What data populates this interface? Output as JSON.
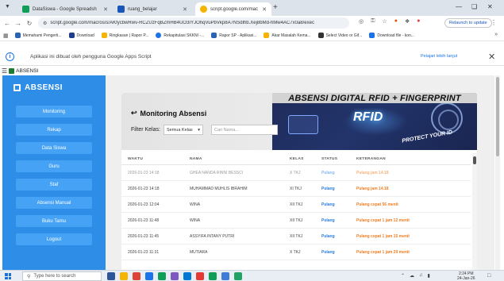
{
  "browser": {
    "tabs": [
      {
        "title": "DataSiswa - Google Spreadsh",
        "color": "#0f9d58",
        "active": false
      },
      {
        "title": "ruang_belajar",
        "color": "#1a56b8",
        "active": false
      },
      {
        "title": "script.google.com/macros/s/A",
        "color": "#f4b400",
        "active": true
      }
    ],
    "url": "script.google.com/macros/s/AKfycbwRwv-RCZUzFqBZmHB4UO3IYJOhqVuPbVkp8A7NSdlhb.Xej8bMd-hMw4AC7x0a8/exec",
    "relaunch_label": "Relaunch to update",
    "bookmarks": [
      {
        "label": "Memahami Pengerti...",
        "color": "#2a62b5"
      },
      {
        "label": "Download",
        "color": "#1c3d8a"
      },
      {
        "label": "Ringkasan | Rapor P...",
        "color": "#f4b400"
      },
      {
        "label": "Rekapitulasi SKKNI -...",
        "color": "#1a73e8"
      },
      {
        "label": "Rapor SP - Aplikasi...",
        "color": "#2a62b5"
      },
      {
        "label": "Akar Masalah Kema...",
        "color": "#f4b400"
      },
      {
        "label": "Select Video or Gif...",
        "color": "#333333"
      },
      {
        "label": "Download file - kon...",
        "color": "#1a73e8"
      }
    ]
  },
  "banner": {
    "text": "Aplikasi ini dibuat oleh pengguna Google Apps Script",
    "link": "Pelajari lebih lanjut"
  },
  "app_title": "ABSENSI",
  "sidebar": {
    "logo": "ABSENSI",
    "items": [
      "Monitoring",
      "Rekap",
      "Data Siswa",
      "Guru",
      "Staf",
      "Absensi Manual",
      "Buku Tamu",
      "Logout"
    ]
  },
  "monitoring": {
    "title": "Monitoring Absensi",
    "filter_label": "Filter Kelas:",
    "filter_value": "Semua Kelas",
    "search_placeholder": "Cari Nama...",
    "hero_title": "ABSENSI DIGITAL RFID + FINGERPRINT",
    "hero_rfid": "RFID",
    "hero_protect": "PROTECT YOUR ID",
    "columns": [
      "WAKTU",
      "NAMA",
      "KELAS",
      "STATUS",
      "KETERANGAN"
    ],
    "rows": [
      {
        "waktu": "2026-01-23 14:18",
        "nama": "GHEA NANDA RINNI BESSCI",
        "kelas": "X TKJ",
        "status": "Pulang",
        "ket": "Pulang jam 14.18",
        "faded": true
      },
      {
        "waktu": "2026-01-23 14:18",
        "nama": "MUHAMMAD MUHLIS IBRAHIM",
        "kelas": "XI TKJ",
        "status": "Pulang",
        "ket": "Pulang jam 14.18",
        "faded": false
      },
      {
        "waktu": "2026-01-23 12:04",
        "nama": "WINA",
        "kelas": "XII TKJ",
        "status": "Pulang",
        "ket": "Pulang cepat 56 menit",
        "faded": false
      },
      {
        "waktu": "2026-01-23 11:48",
        "nama": "WINA",
        "kelas": "XII TKJ",
        "status": "Pulang",
        "ket": "Pulang cepat 1 jam 12 menit",
        "faded": false
      },
      {
        "waktu": "2026-01-23 11:45",
        "nama": "ASSYIFA INTANY PUTRI",
        "kelas": "XII TKJ",
        "status": "Pulang",
        "ket": "Pulang cepat 1 jam 15 menit",
        "faded": false
      },
      {
        "waktu": "2026-01-23 11:31",
        "nama": "MUTIARA",
        "kelas": "X TKJ",
        "status": "Pulang",
        "ket": "Pulang cepat 1 jam 29 menit",
        "faded": false
      }
    ]
  },
  "taskbar": {
    "search_placeholder": "Type here to search",
    "time": "2:24 PM",
    "date": "24-Jan-26",
    "app_colors": [
      "#2b579a",
      "#f4b400",
      "#db4437",
      "#1a73e8",
      "#0f9d58",
      "#7e57c2",
      "#0078d4",
      "#e53935",
      "#0f9d58",
      "#3d7dd8",
      "#21a366"
    ]
  }
}
